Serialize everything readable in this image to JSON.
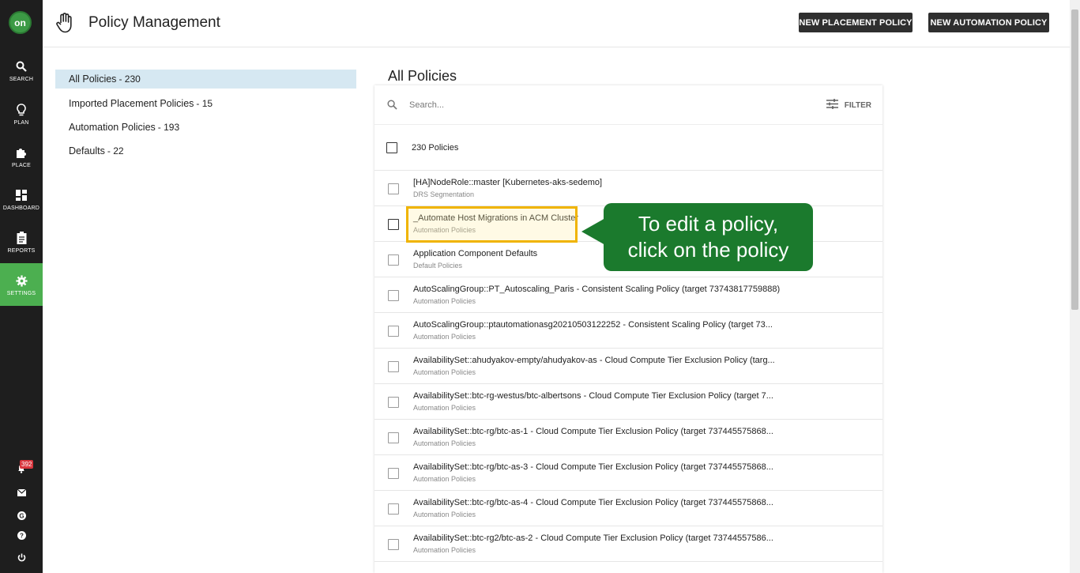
{
  "app": {
    "logo_text": "on",
    "accent_color": "#4caf50"
  },
  "nav": {
    "items": [
      {
        "label": "SEARCH",
        "icon": "search-icon"
      },
      {
        "label": "PLAN",
        "icon": "lightbulb-icon"
      },
      {
        "label": "PLACE",
        "icon": "puzzle-icon"
      },
      {
        "label": "DASHBOARD",
        "icon": "dashboard-icon"
      },
      {
        "label": "REPORTS",
        "icon": "clipboard-icon"
      },
      {
        "label": "SETTINGS",
        "icon": "gear-icon",
        "active": true
      }
    ],
    "notification_count": "392"
  },
  "header": {
    "title": "Policy Management",
    "new_placement_label": "NEW PLACEMENT POLICY",
    "new_automation_label": "NEW AUTOMATION POLICY"
  },
  "categories": [
    {
      "label": "All Policies",
      "count": "- 230",
      "active": true
    },
    {
      "label": "Imported Placement Policies",
      "count": "- 15"
    },
    {
      "label": "Automation Policies",
      "count": "- 193"
    },
    {
      "label": "Defaults",
      "count": "- 22"
    }
  ],
  "main": {
    "title": "All Policies",
    "search_placeholder": "Search...",
    "filter_label": "FILTER",
    "select_all_label": "230 Policies"
  },
  "policies": [
    {
      "name": "[HA]NodeRole::master [Kubernetes-aks-sedemo]",
      "category": "DRS Segmentation"
    },
    {
      "name": "_Automate Host Migrations in ACM Cluster",
      "category": "Automation Policies"
    },
    {
      "name": "Application Component Defaults",
      "category": "Default Policies"
    },
    {
      "name": "AutoScalingGroup::PT_Autoscaling_Paris - Consistent Scaling Policy (target 73743817759888)",
      "category": "Automation Policies"
    },
    {
      "name": "AutoScalingGroup::ptautomationasg20210503122252 - Consistent Scaling Policy (target 73...",
      "category": "Automation Policies"
    },
    {
      "name": "AvailabilitySet::ahudyakov-empty/ahudyakov-as - Cloud Compute Tier Exclusion Policy (targ...",
      "category": "Automation Policies"
    },
    {
      "name": "AvailabilitySet::btc-rg-westus/btc-albertsons - Cloud Compute Tier Exclusion Policy (target 7...",
      "category": "Automation Policies"
    },
    {
      "name": "AvailabilitySet::btc-rg/btc-as-1 - Cloud Compute Tier Exclusion Policy (target 737445575868...",
      "category": "Automation Policies"
    },
    {
      "name": "AvailabilitySet::btc-rg/btc-as-3 - Cloud Compute Tier Exclusion Policy (target 737445575868...",
      "category": "Automation Policies"
    },
    {
      "name": "AvailabilitySet::btc-rg/btc-as-4 - Cloud Compute Tier Exclusion Policy (target 737445575868...",
      "category": "Automation Policies"
    },
    {
      "name": "AvailabilitySet::btc-rg2/btc-as-2 - Cloud Compute Tier Exclusion Policy (target 73744557586...",
      "category": "Automation Policies"
    }
  ],
  "callout": {
    "line1": "To edit a policy,",
    "line2": "click on the policy",
    "color": "#1b7a2d",
    "highlight_color": "#f0b400"
  }
}
